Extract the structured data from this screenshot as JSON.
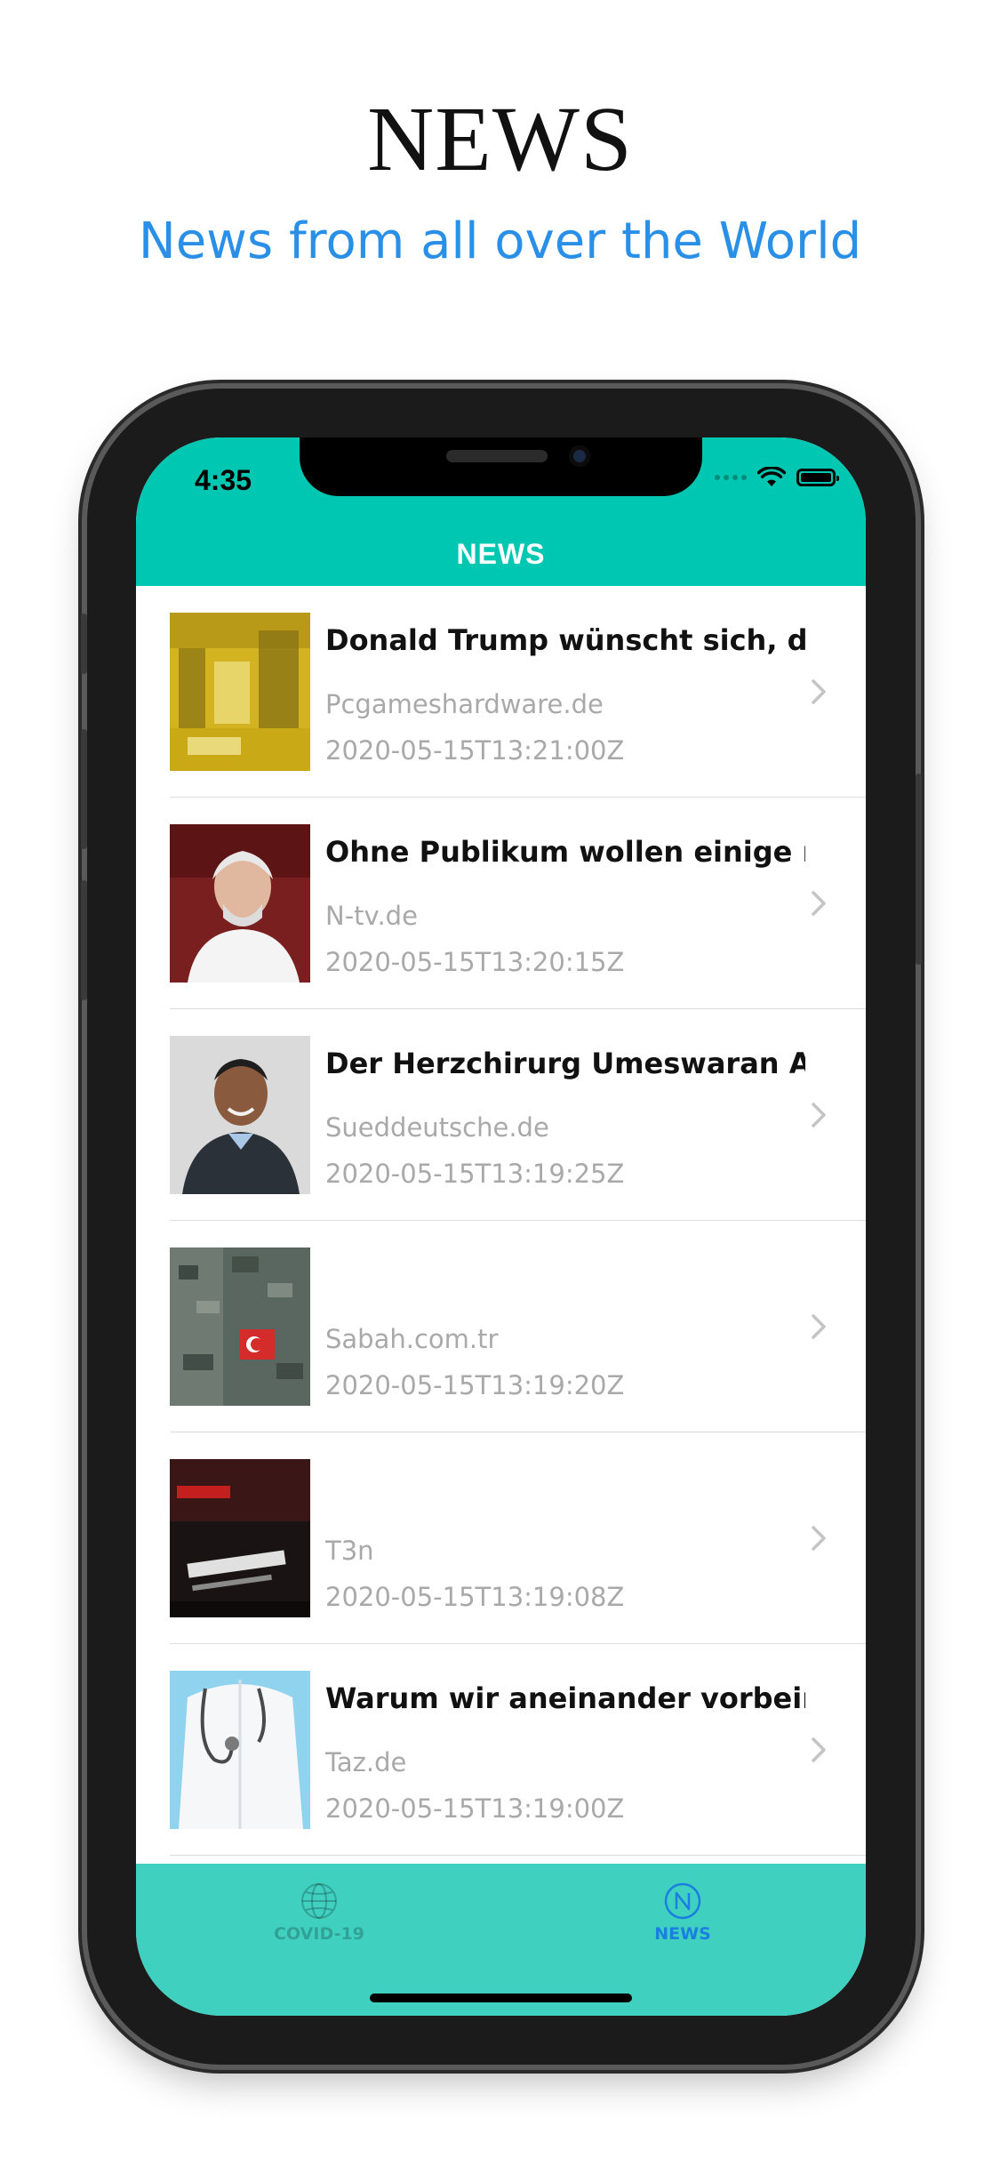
{
  "promo": {
    "headline": "NEWS",
    "subheadline": "News from all over the World",
    "subheadline_color": "#2a8fe6"
  },
  "status_bar": {
    "time": "4:35",
    "icons": [
      "signal-dots-icon",
      "wifi-icon",
      "battery-icon"
    ]
  },
  "nav": {
    "title": "NEWS",
    "color": "#00c7b1"
  },
  "articles": [
    {
      "title": "Donald Trump wünscht sich, dass",
      "source": "Pcgameshardware.de",
      "date": "2020-05-15T13:21:00Z",
      "thumbnail": "lab-factory-image"
    },
    {
      "title": "Ohne Publikum wollen einige nic",
      "source": "N-tv.de",
      "date": "2020-05-15T13:20:15Z",
      "thumbnail": "older-man-portrait-image"
    },
    {
      "title": "Der Herzchirurg Umeswaran Aru",
      "source": "Sueddeutsche.de",
      "date": "2020-05-15T13:19:25Z",
      "thumbnail": "smiling-man-portrait-image"
    },
    {
      "title": "",
      "source": "Sabah.com.tr",
      "date": "2020-05-15T13:19:20Z",
      "thumbnail": "military-uniform-flag-image"
    },
    {
      "title": "",
      "source": "T3n",
      "date": "2020-05-15T13:19:08Z",
      "thumbnail": "netflix-screen-image"
    },
    {
      "title": "Warum wir aneinander vorbeired",
      "source": "Taz.de",
      "date": "2020-05-15T13:19:00Z",
      "thumbnail": "doctor-coat-stethoscope-image"
    }
  ],
  "tab_bar": {
    "tabs": [
      {
        "label": "COVID-19",
        "icon": "globe-icon",
        "active": false
      },
      {
        "label": "NEWS",
        "icon": "news-n-icon",
        "active": true
      }
    ],
    "color": "#3fd0bf",
    "active_color": "#1a7fe0"
  }
}
